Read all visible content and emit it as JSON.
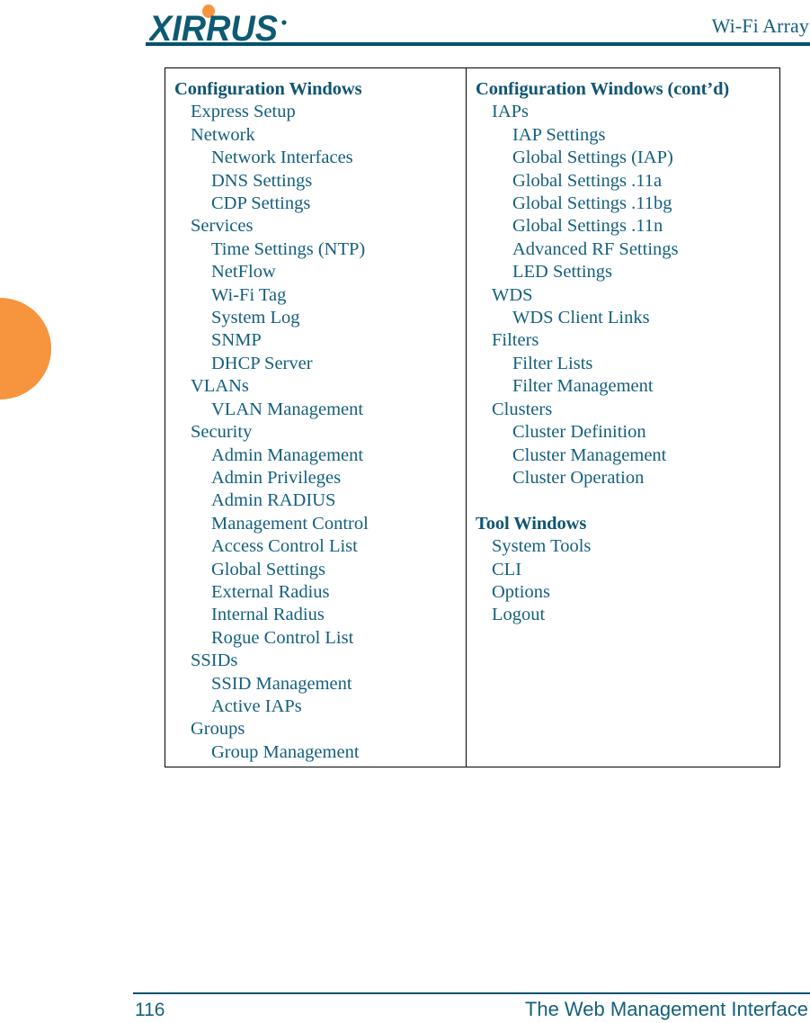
{
  "header": {
    "logo_text": "XIRRUS",
    "logo_trademark": "®",
    "title": "Wi-Fi Array"
  },
  "colors": {
    "teal": "#14607f",
    "rule_teal": "#00526b",
    "orange": "#f7943e",
    "border": "#000000"
  },
  "toc": {
    "left_column": [
      {
        "level": 0,
        "label": "Configuration Windows"
      },
      {
        "level": 1,
        "label": "Express Setup"
      },
      {
        "level": 1,
        "label": "Network"
      },
      {
        "level": 2,
        "label": "Network Interfaces"
      },
      {
        "level": 2,
        "label": "DNS Settings"
      },
      {
        "level": 2,
        "label": "CDP Settings"
      },
      {
        "level": 1,
        "label": "Services"
      },
      {
        "level": 2,
        "label": "Time Settings (NTP)"
      },
      {
        "level": 2,
        "label": "NetFlow"
      },
      {
        "level": 2,
        "label": "Wi-Fi Tag"
      },
      {
        "level": 2,
        "label": "System Log"
      },
      {
        "level": 2,
        "label": "SNMP"
      },
      {
        "level": 2,
        "label": "DHCP Server"
      },
      {
        "level": 1,
        "label": "VLANs"
      },
      {
        "level": 2,
        "label": "VLAN Management"
      },
      {
        "level": 1,
        "label": "Security"
      },
      {
        "level": 2,
        "label": "Admin Management"
      },
      {
        "level": 2,
        "label": "Admin Privileges"
      },
      {
        "level": 2,
        "label": "Admin RADIUS"
      },
      {
        "level": 2,
        "label": "Management Control"
      },
      {
        "level": 2,
        "label": "Access Control List"
      },
      {
        "level": 2,
        "label": "Global Settings"
      },
      {
        "level": 2,
        "label": "External Radius"
      },
      {
        "level": 2,
        "label": "Internal Radius"
      },
      {
        "level": 2,
        "label": "Rogue Control List"
      },
      {
        "level": 1,
        "label": "SSIDs"
      },
      {
        "level": 2,
        "label": "SSID Management"
      },
      {
        "level": 2,
        "label": "Active IAPs"
      },
      {
        "level": 1,
        "label": "Groups"
      },
      {
        "level": 2,
        "label": "Group Management"
      }
    ],
    "right_column": [
      {
        "level": 0,
        "label": "Configuration Windows (cont’d)"
      },
      {
        "level": 1,
        "label": "IAPs"
      },
      {
        "level": 2,
        "label": "IAP Settings"
      },
      {
        "level": 2,
        "label": "Global Settings (IAP)"
      },
      {
        "level": 2,
        "label": "Global Settings .11a"
      },
      {
        "level": 2,
        "label": "Global Settings .11bg"
      },
      {
        "level": 2,
        "label": "Global Settings .11n"
      },
      {
        "level": 2,
        "label": "Advanced RF Settings"
      },
      {
        "level": 2,
        "label": "LED Settings"
      },
      {
        "level": 1,
        "label": "WDS"
      },
      {
        "level": 2,
        "label": "WDS Client Links"
      },
      {
        "level": 1,
        "label": "Filters"
      },
      {
        "level": 2,
        "label": "Filter Lists"
      },
      {
        "level": 2,
        "label": "Filter Management"
      },
      {
        "level": 1,
        "label": "Clusters"
      },
      {
        "level": 2,
        "label": "Cluster Definition"
      },
      {
        "level": 2,
        "label": "Cluster Management"
      },
      {
        "level": 2,
        "label": "Cluster Operation"
      },
      {
        "level": -1,
        "label": ""
      },
      {
        "level": 0,
        "label": "Tool Windows"
      },
      {
        "level": 1,
        "label": "System Tools"
      },
      {
        "level": 1,
        "label": "CLI"
      },
      {
        "level": 1,
        "label": "Options"
      },
      {
        "level": 1,
        "label": "Logout"
      }
    ]
  },
  "footer": {
    "page_number": "116",
    "section_title": "The Web Management Interface"
  }
}
